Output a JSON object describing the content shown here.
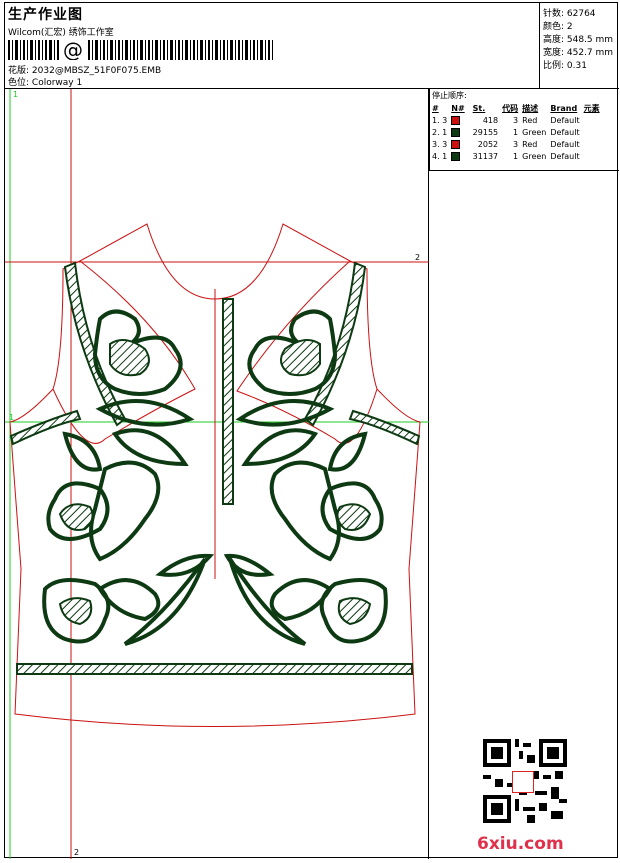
{
  "header": {
    "title": "生产作业图",
    "software": "Wilcom(汇宏) 绣饰工作室",
    "design_label": "花版:",
    "design_value": "2032@MBSZ_51F0F075.EMB",
    "color_label": "色位:",
    "color_value": "Colorway 1"
  },
  "stats": {
    "stitches": "针数: 62764",
    "colors": "颜色: 2",
    "height": "高度: 548.5 mm",
    "width": "宽度: 452.7 mm",
    "scale": "比例: 0.31"
  },
  "sequence": {
    "caption": "停止顺序:",
    "headers": [
      "#",
      "N#",
      "",
      "St.",
      "代码",
      "描述",
      "Brand",
      "元素"
    ],
    "rows": [
      {
        "idx": "1. 3",
        "color": "#cc1111",
        "st": "418",
        "code": "3",
        "desc": "Red",
        "brand": "Default"
      },
      {
        "idx": "2. 1",
        "color": "#0d3a12",
        "st": "29155",
        "code": "1",
        "desc": "Green",
        "brand": "Default"
      },
      {
        "idx": "3. 3",
        "color": "#cc1111",
        "st": "2052",
        "code": "3",
        "desc": "Red",
        "brand": "Default"
      },
      {
        "idx": "4. 1",
        "color": "#0d3a12",
        "st": "31137",
        "code": "1",
        "desc": "Green",
        "brand": "Default"
      }
    ]
  },
  "guides": {
    "top_h": "2",
    "mid_h": "1",
    "left_v": "1",
    "bottom_v": "2"
  },
  "watermark": {
    "brand": "6xiu.com",
    "seal": "印章"
  },
  "colors": {
    "embroidery": "#0d3a12",
    "outline": "#cc1111",
    "guide": "#22cc22"
  }
}
